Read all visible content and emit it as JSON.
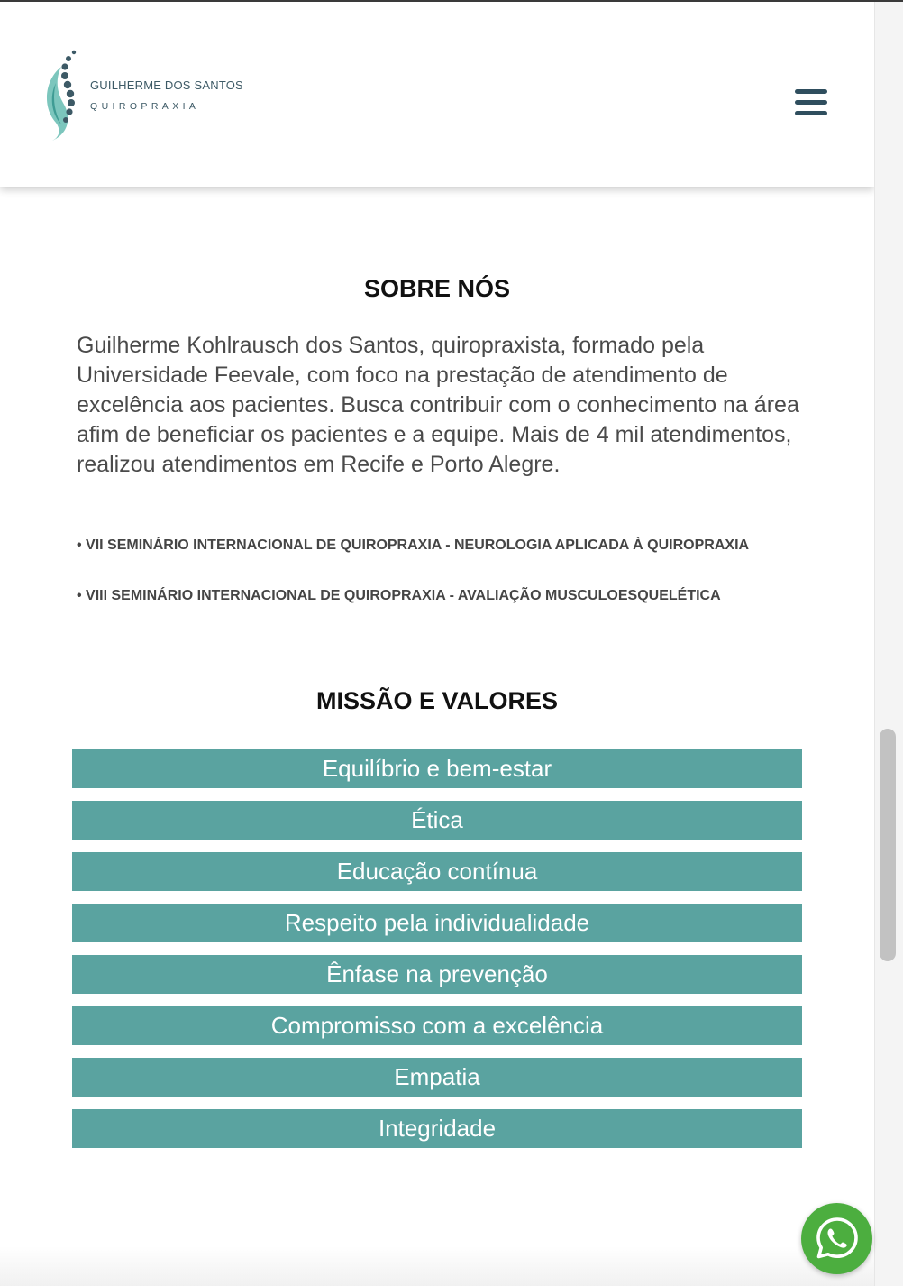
{
  "header": {
    "brand_name": "GUILHERME DOS SANTOS",
    "brand_sub": "QUIROPRAXIA",
    "menu_icon": "hamburger-menu-icon"
  },
  "about": {
    "title": "SOBRE NÓS",
    "text": "Guilherme Kohlrausch dos Santos, quiropraxista, formado pela Universidade Feevale, com foco na prestação de atendimento de excelência aos pacientes. Busca contribuir com o conhecimento na área afim de beneficiar os pacientes e a equipe. Mais de 4 mil atendimentos, realizou atendimentos em Recife e Porto Alegre.",
    "certifications": [
      "• VII SEMINÁRIO INTERNACIONAL DE QUIROPRAXIA - NEUROLOGIA APLICADA À QUIROPRAXIA",
      "• VIII SEMINÁRIO INTERNACIONAL DE QUIROPRAXIA - AVALIAÇÃO MUSCULOESQUELÉTICA"
    ]
  },
  "values": {
    "title": "MISSÃO E VALORES",
    "items": [
      "Equilíbrio e bem-estar",
      "Ética",
      "Educação contínua",
      "Respeito pela individualidade",
      "Ênfase na prevenção",
      "Compromisso com a excelência",
      "Empatia",
      "Integridade"
    ]
  },
  "colors": {
    "accent": "#5aa3a0",
    "brand_dark": "#2f4e5e",
    "whatsapp": "#4cae3f"
  },
  "whatsapp_icon": "whatsapp-icon"
}
